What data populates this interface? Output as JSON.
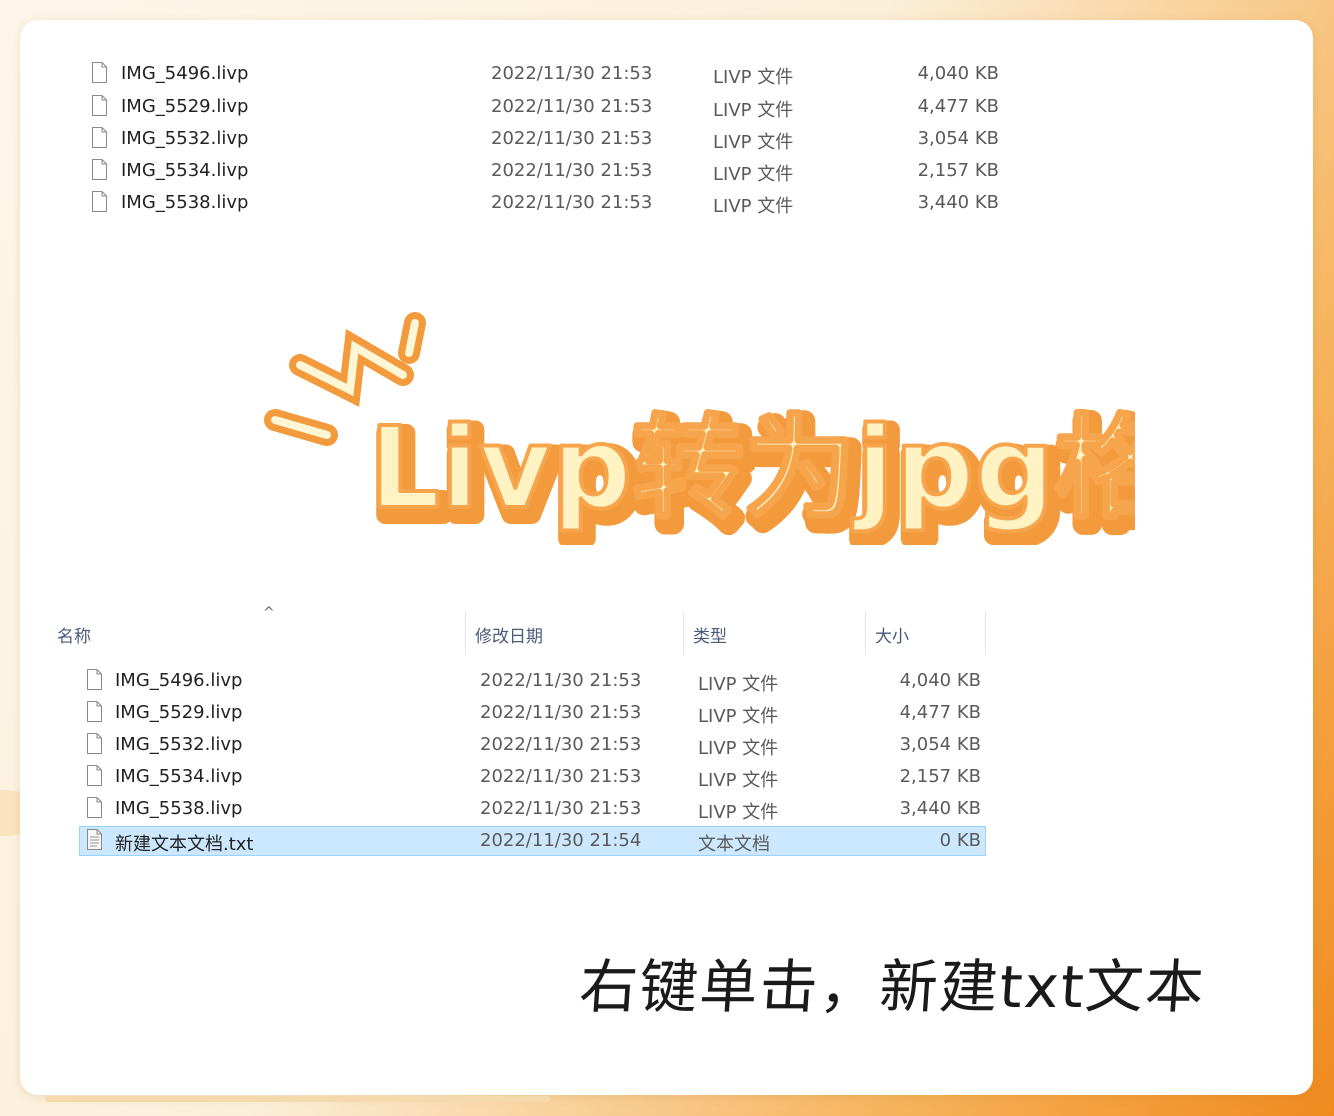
{
  "title": "Livp转为jpg格式",
  "caption": "右键单击，新建txt文本",
  "columns": {
    "name": "名称",
    "date": "修改日期",
    "type": "类型",
    "size": "大小"
  },
  "top_files": [
    {
      "name": "IMG_5496.livp",
      "date": "2022/11/30 21:53",
      "type": "LIVP 文件",
      "size": "4,040 KB"
    },
    {
      "name": "IMG_5529.livp",
      "date": "2022/11/30 21:53",
      "type": "LIVP 文件",
      "size": "4,477 KB"
    },
    {
      "name": "IMG_5532.livp",
      "date": "2022/11/30 21:53",
      "type": "LIVP 文件",
      "size": "3,054 KB"
    },
    {
      "name": "IMG_5534.livp",
      "date": "2022/11/30 21:53",
      "type": "LIVP 文件",
      "size": "2,157 KB"
    },
    {
      "name": "IMG_5538.livp",
      "date": "2022/11/30 21:53",
      "type": "LIVP 文件",
      "size": "3,440 KB"
    }
  ],
  "bottom_files": [
    {
      "name": "IMG_5496.livp",
      "date": "2022/11/30 21:53",
      "type": "LIVP 文件",
      "size": "4,040 KB"
    },
    {
      "name": "IMG_5529.livp",
      "date": "2022/11/30 21:53",
      "type": "LIVP 文件",
      "size": "4,477 KB"
    },
    {
      "name": "IMG_5532.livp",
      "date": "2022/11/30 21:53",
      "type": "LIVP 文件",
      "size": "3,054 KB"
    },
    {
      "name": "IMG_5534.livp",
      "date": "2022/11/30 21:53",
      "type": "LIVP 文件",
      "size": "2,157 KB"
    },
    {
      "name": "IMG_5538.livp",
      "date": "2022/11/30 21:53",
      "type": "LIVP 文件",
      "size": "3,440 KB"
    },
    {
      "name": "新建文本文档.txt",
      "date": "2022/11/30 21:54",
      "type": "文本文档",
      "size": "0 KB",
      "selected": true
    }
  ],
  "colors": {
    "title_fill": "#fff3c4",
    "title_outline": "#f39a3d",
    "selection": "#cce8ff"
  }
}
